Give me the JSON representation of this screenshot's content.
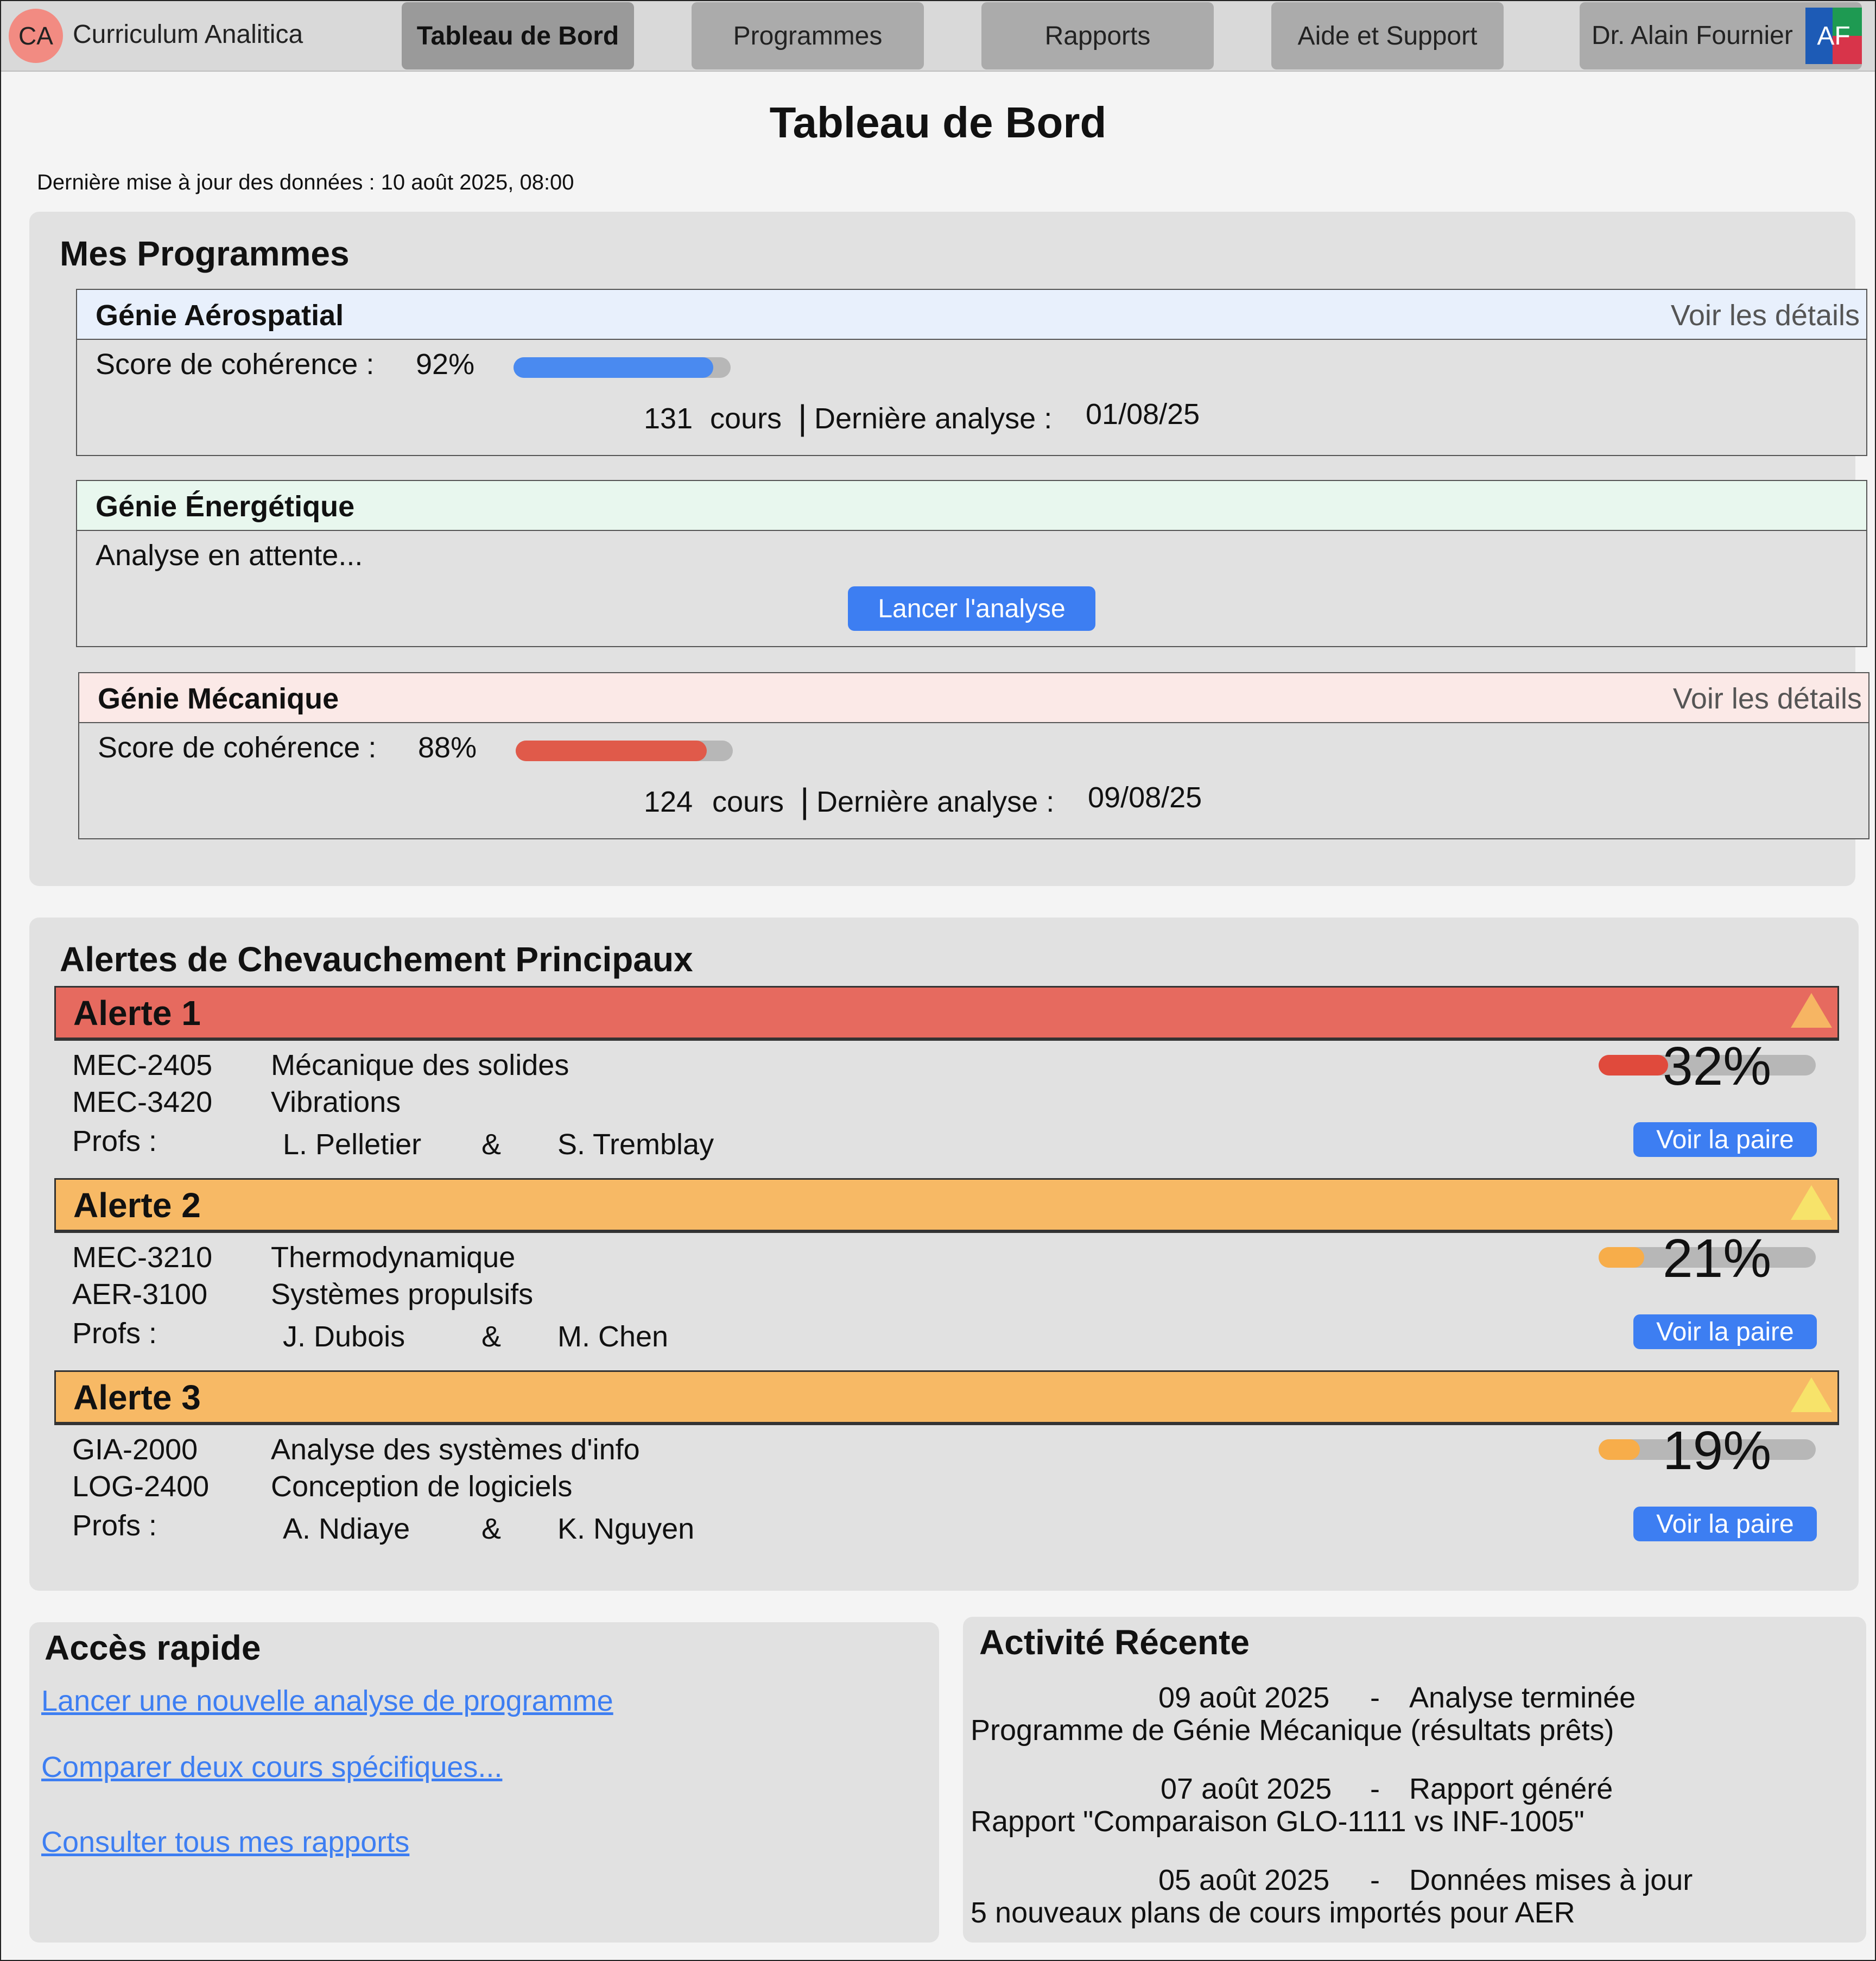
{
  "header": {
    "logo": "CA",
    "brand": "Curriculum Analitica",
    "tabs": [
      "Tableau de Bord",
      "Programmes",
      "Rapports",
      "Aide et Support"
    ],
    "user_name": "Dr. Alain Fournier",
    "user_initials": "AF"
  },
  "page": {
    "title": "Tableau de Bord",
    "updated": "Dernière mise à jour des données : 10 août 2025, 08:00"
  },
  "programs": {
    "title": "Mes Programmes",
    "items": [
      {
        "name": "Génie Aérospatial",
        "link": "Voir les détails",
        "score_label": "Score de cohérence :",
        "score_text": "92%",
        "score": 0.92,
        "courses": "131",
        "courses_label": "cours",
        "last_label": "Dernière analyse :",
        "last_date": "01/08/25",
        "color": "#4a8af0",
        "head_bg": "#e8f0fc"
      },
      {
        "name": "Génie Énergétique",
        "status": "Analyse en attente...",
        "button": "Lancer l'analyse",
        "head_bg": "#e8f7ee"
      },
      {
        "name": "Génie Mécanique",
        "link": "Voir les détails",
        "score_label": "Score de cohérence :",
        "score_text": "88%",
        "score": 0.88,
        "courses": "124",
        "courses_label": "cours",
        "last_label": "Dernière analyse :",
        "last_date": "09/08/25",
        "color": "#e05a4a",
        "head_bg": "#fbe9e7"
      }
    ]
  },
  "alerts": {
    "title": "Alertes de Chevauchement Principaux",
    "items": [
      {
        "title": "Alerte 1",
        "code1": "MEC-2405",
        "course1": "Mécanique des solides",
        "code2": "MEC-3420",
        "course2": "Vibrations",
        "profs_label": "Profs :",
        "prof1": "L. Pelletier",
        "amp": "&",
        "prof2": "S. Tremblay",
        "pct_text": "32%",
        "pct": 0.32,
        "button": "Voir la paire",
        "head_color": "#e66a5f",
        "bar_color": "#e04a3c",
        "tri_color": "#f6b563"
      },
      {
        "title": "Alerte 2",
        "code1": "MEC-3210",
        "course1": "Thermodynamique",
        "code2": "AER-3100",
        "course2": "Systèmes propulsifs",
        "profs_label": "Profs :",
        "prof1": "J. Dubois",
        "amp": "&",
        "prof2": "M. Chen",
        "pct_text": "21%",
        "pct": 0.21,
        "button": "Voir la paire",
        "head_color": "#f7b965",
        "bar_color": "#f7ad4a",
        "tri_color": "#f7e36a"
      },
      {
        "title": "Alerte 3",
        "code1": "GIA-2000",
        "course1": "Analyse des systèmes d'info",
        "code2": "LOG-2400",
        "course2": "Conception de logiciels",
        "profs_label": "Profs :",
        "prof1": "A. Ndiaye",
        "amp": "&",
        "prof2": "K. Nguyen",
        "pct_text": "19%",
        "pct": 0.19,
        "button": "Voir la paire",
        "head_color": "#f7b965",
        "bar_color": "#f7ad4a",
        "tri_color": "#f7e36a"
      }
    ]
  },
  "quick": {
    "title": "Accès rapide",
    "links": [
      "Lancer une nouvelle analyse de programme",
      "Comparer deux cours spécifiques...",
      "Consulter tous mes rapports"
    ]
  },
  "activity": {
    "title": "Activité Récente",
    "items": [
      {
        "date": "09 août 2025",
        "sep": "-",
        "event": "Analyse terminée",
        "detail": "Programme de Génie Mécanique (résultats prêts)"
      },
      {
        "date": "07 août 2025",
        "sep": "-",
        "event": "Rapport généré",
        "detail": "Rapport \"Comparaison GLO-1111 vs INF-1005\""
      },
      {
        "date": "05 août 2025",
        "sep": "-",
        "event": "Données mises à jour",
        "detail": "5 nouveaux plans de cours importés pour AER"
      }
    ]
  }
}
